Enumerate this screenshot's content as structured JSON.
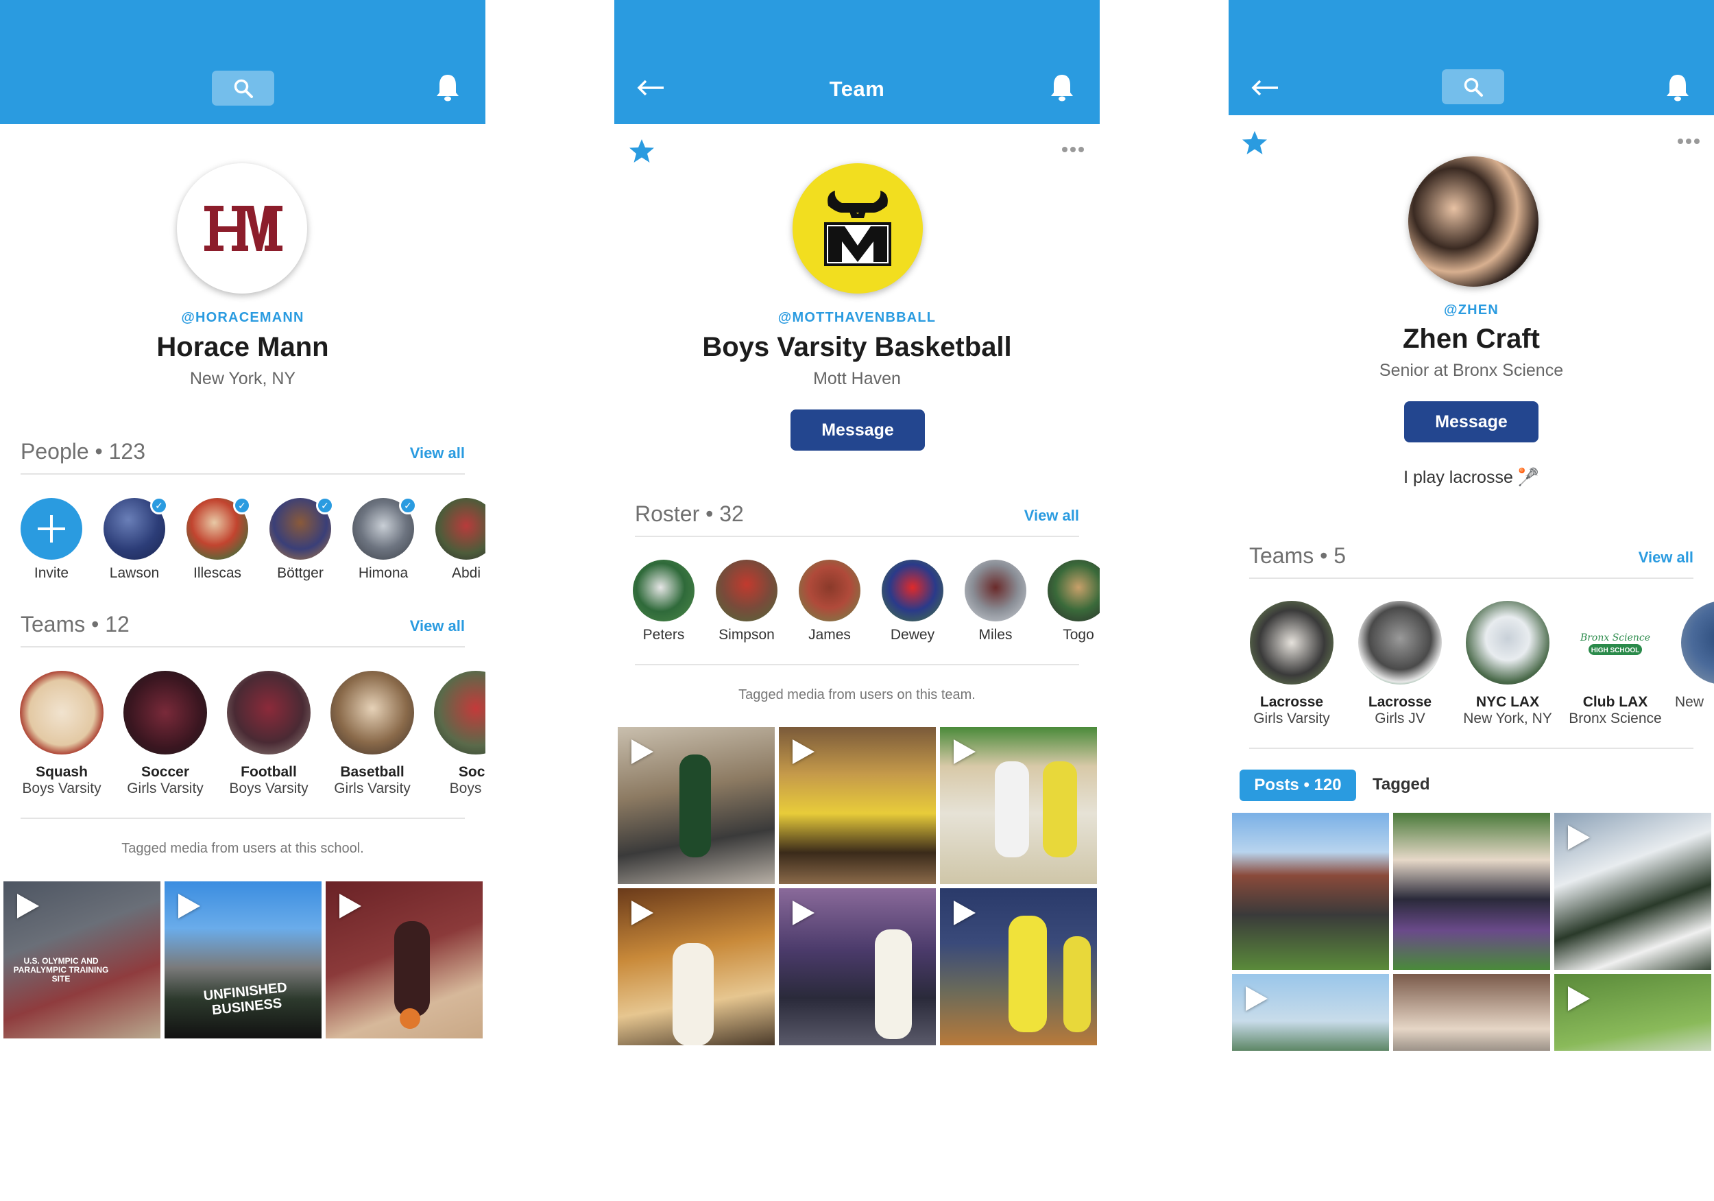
{
  "colors": {
    "brand_blue": "#2a9be0",
    "message_button": "#23468f",
    "motthaven_yellow": "#f2de1f",
    "horacemann_maroon": "#8c1d2b"
  },
  "screen1": {
    "profile": {
      "handle": "@HORACEMANN",
      "name": "Horace Mann",
      "location": "New York, NY"
    },
    "people": {
      "title": "People • 123",
      "view_all": "View all",
      "invite_label": "Invite",
      "items": [
        {
          "label": "Lawson",
          "verified": true
        },
        {
          "label": "Illescas",
          "verified": true
        },
        {
          "label": "Böttger",
          "verified": true
        },
        {
          "label": "Himona",
          "verified": true
        },
        {
          "label": "Abdi",
          "verified": false
        }
      ]
    },
    "teams": {
      "title": "Teams • 12",
      "view_all": "View all",
      "items": [
        {
          "name": "Squash",
          "sub": "Boys Varsity"
        },
        {
          "name": "Soccer",
          "sub": "Girls Varsity"
        },
        {
          "name": "Football",
          "sub": "Boys Varsity"
        },
        {
          "name": "Basetball",
          "sub": "Girls Varsity"
        },
        {
          "name": "Socc",
          "sub": "Boys Va"
        }
      ]
    },
    "caption": "Tagged media from users at this school.",
    "media_tiles": [
      {
        "play": true,
        "text": "U.S. OLYMPIC AND PARALYMPIC TRAINING SITE"
      },
      {
        "play": true,
        "text": "UNFINISHED BUSINESS"
      },
      {
        "play": true,
        "text": ""
      }
    ]
  },
  "screen2": {
    "header_title": "Team",
    "profile": {
      "handle": "@MOTTHAVENBBALL",
      "name": "Boys Varsity Basketball",
      "location": "Mott Haven"
    },
    "message_button": "Message",
    "roster": {
      "title": "Roster • 32",
      "view_all": "View all",
      "items": [
        {
          "label": "Peters"
        },
        {
          "label": "Simpson"
        },
        {
          "label": "James"
        },
        {
          "label": "Dewey"
        },
        {
          "label": "Miles"
        },
        {
          "label": "Togo"
        }
      ]
    },
    "caption": "Tagged media from users on this team.",
    "media_tiles": [
      {
        "play": true
      },
      {
        "play": true
      },
      {
        "play": true
      },
      {
        "play": true
      },
      {
        "play": true
      },
      {
        "play": true
      }
    ]
  },
  "screen3": {
    "profile": {
      "handle": "@ZHEN",
      "name": "Zhen Craft",
      "subtitle": "Senior at Bronx Science"
    },
    "message_button": "Message",
    "bio": "I play lacrosse 🥍",
    "teams": {
      "title": "Teams • 5",
      "view_all": "View all",
      "items": [
        {
          "name": "Lacrosse",
          "sub": "Girls Varsity"
        },
        {
          "name": "Lacrosse",
          "sub": "Girls JV"
        },
        {
          "name": "NYC LAX",
          "sub": "New York, NY"
        },
        {
          "name": "Club LAX",
          "sub": "Bronx Science"
        },
        {
          "name": "",
          "sub": "New"
        }
      ]
    },
    "tabs": {
      "posts": "Posts • 120",
      "tagged": "Tagged"
    },
    "media_tiles": [
      {
        "play": false
      },
      {
        "play": false
      },
      {
        "play": true
      },
      {
        "play": true
      },
      {
        "play": false
      },
      {
        "play": true
      }
    ]
  }
}
